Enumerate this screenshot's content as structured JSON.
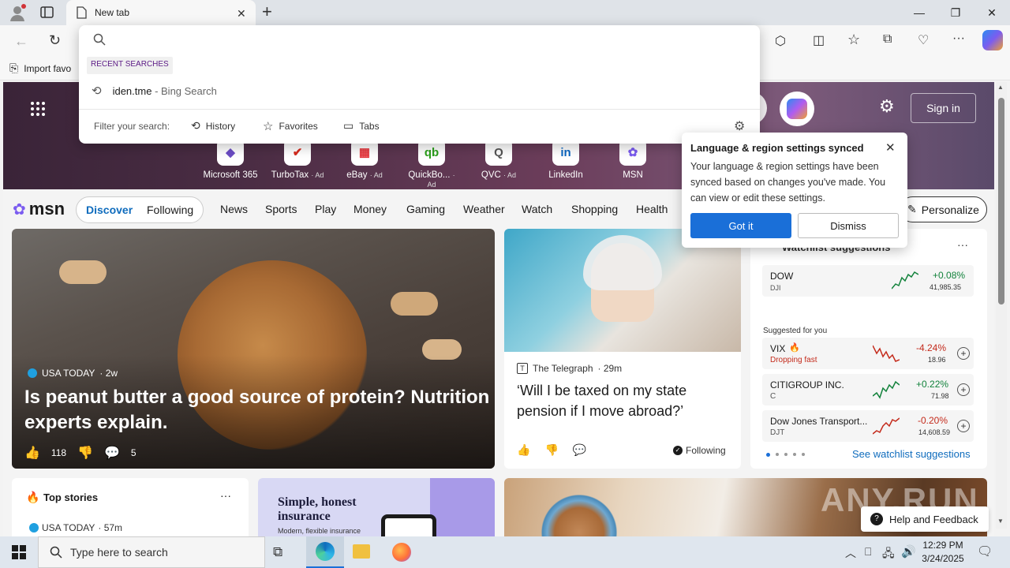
{
  "browser": {
    "tab_title": "New tab",
    "new_tab_symbol": "+",
    "address_value": "",
    "fav_bar_item": "Import favo"
  },
  "dropdown": {
    "recent_header": "RECENT SEARCHES",
    "recent_item_main": "iden.tme",
    "recent_item_suffix": " - Bing Search",
    "filter_label": "Filter your search:",
    "filters": [
      "History",
      "Favorites",
      "Tabs"
    ]
  },
  "hero": {
    "sign_in": "Sign in",
    "tiles": [
      {
        "label": "Microsoft 365",
        "ad": "",
        "glyph": "◆",
        "color": "#6b4cc4"
      },
      {
        "label": "TurboTax",
        "ad": "· Ad",
        "glyph": "✔",
        "color": "#d52b1e"
      },
      {
        "label": "eBay",
        "ad": "· Ad",
        "glyph": "▦",
        "color": "#e53238"
      },
      {
        "label": "QuickBo...",
        "ad": "· Ad",
        "glyph": "qb",
        "color": "#2ca01c"
      },
      {
        "label": "QVC",
        "ad": "· Ad",
        "glyph": "Q",
        "color": "#555555"
      },
      {
        "label": "LinkedIn",
        "ad": "",
        "glyph": "in",
        "color": "#0a66c2"
      },
      {
        "label": "MSN",
        "ad": "",
        "glyph": "✿",
        "color": "#7b5cf0"
      }
    ]
  },
  "nav": {
    "logo": "msn",
    "discover": "Discover",
    "following": "Following",
    "links": [
      "News",
      "Sports",
      "Play",
      "Money",
      "Gaming",
      "Weather",
      "Watch",
      "Shopping",
      "Health"
    ],
    "personalize": "Personalize"
  },
  "main_story": {
    "source": "USA TODAY",
    "age": "· 2w",
    "title": "Is peanut butter a good source of protein? Nutrition experts explain.",
    "likes": "118",
    "comments": "5"
  },
  "second_story": {
    "source": "The Telegraph",
    "age": "· 29m",
    "title": "‘Will I be taxed on my state pension if I move abroad?’",
    "following": "Following"
  },
  "watchlist": {
    "title": "Watchlist suggestions",
    "top": {
      "name": "DOW",
      "ticker": "DJI",
      "change": "+0.08%",
      "price": "41,985.35",
      "color": "#12823b"
    },
    "suggested_label": "Suggested for you",
    "items": [
      {
        "name": "VIX",
        "sub": "Dropping fast",
        "change": "-4.24%",
        "price": "18.96",
        "color": "#c42b1c"
      },
      {
        "name": "CITIGROUP INC.",
        "sub": "C",
        "change": "+0.22%",
        "price": "71.98",
        "color": "#12823b"
      },
      {
        "name": "Dow Jones Transport...",
        "sub": "DJT",
        "change": "-0.20%",
        "price": "14,608.59",
        "color": "#c42b1c"
      }
    ],
    "see_more": "See watchlist suggestions"
  },
  "top_stories": {
    "title": "Top stories",
    "source": "USA TODAY",
    "age": "· 57m"
  },
  "insurance_ad": {
    "title": "Simple, honest insurance",
    "sub": "Modern, flexible insurance"
  },
  "popup": {
    "title": "Language & region settings synced",
    "body": "Your language & region settings have been synced based on changes you've made. You can view or edit these settings.",
    "got_it": "Got it",
    "dismiss": "Dismiss"
  },
  "help": {
    "label": "Help and Feedback"
  },
  "watermark": {
    "text": "ANY.RUN"
  },
  "taskbar": {
    "search_placeholder": "Type here to search",
    "time": "12:29 PM",
    "date": "3/24/2025"
  },
  "colors": {
    "accent": "#0f6cbd",
    "primary_button": "#1a6fd8"
  }
}
